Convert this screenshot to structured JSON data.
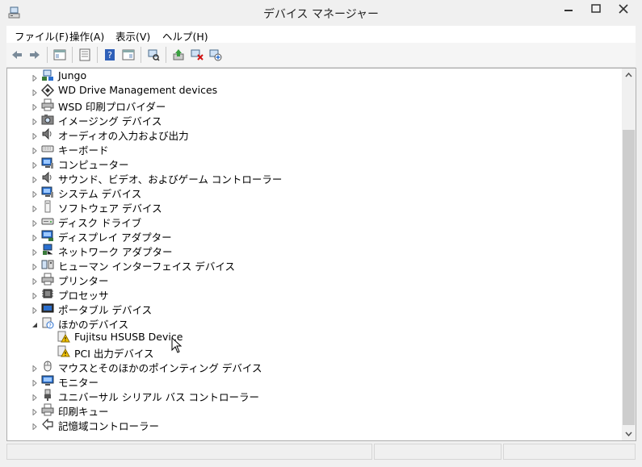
{
  "window": {
    "title": "デバイス マネージャー",
    "icon": "device-manager-icon"
  },
  "menubar": {
    "items": [
      {
        "label": "ファイル(F)"
      },
      {
        "label": "操作(A)"
      },
      {
        "label": "表示(V)"
      },
      {
        "label": "ヘルプ(H)"
      }
    ]
  },
  "toolbar": {
    "buttons": [
      {
        "icon": "back-arrow-icon"
      },
      {
        "icon": "forward-arrow-icon"
      },
      {
        "icon": "show-hide-console-tree-icon"
      },
      {
        "icon": "properties-icon"
      },
      {
        "icon": "help-icon"
      },
      {
        "icon": "action-pane-icon"
      },
      {
        "icon": "scan-hardware-changes-icon"
      },
      {
        "icon": "update-driver-icon"
      },
      {
        "icon": "uninstall-device-icon"
      },
      {
        "icon": "add-legacy-hardware-icon"
      }
    ]
  },
  "tree": {
    "items": [
      {
        "label": "Jungo",
        "icon": "network-device-icon",
        "expanded": false,
        "level": 1
      },
      {
        "label": "WD Drive Management devices",
        "icon": "wd-diamond-icon",
        "expanded": false,
        "level": 1
      },
      {
        "label": "WSD 印刷プロバイダー",
        "icon": "printer-icon",
        "expanded": false,
        "level": 1
      },
      {
        "label": "イメージング デバイス",
        "icon": "camera-icon",
        "expanded": false,
        "level": 1
      },
      {
        "label": "オーディオの入力および出力",
        "icon": "speaker-icon",
        "expanded": false,
        "level": 1
      },
      {
        "label": "キーボード",
        "icon": "keyboard-icon",
        "expanded": false,
        "level": 1
      },
      {
        "label": "コンピューター",
        "icon": "computer-icon",
        "expanded": false,
        "level": 1
      },
      {
        "label": "サウンド、ビデオ、およびゲーム コントローラー",
        "icon": "speaker-icon",
        "expanded": false,
        "level": 1
      },
      {
        "label": "システム デバイス",
        "icon": "computer-icon",
        "expanded": false,
        "level": 1
      },
      {
        "label": "ソフトウェア デバイス",
        "icon": "software-device-icon",
        "expanded": false,
        "level": 1
      },
      {
        "label": "ディスク ドライブ",
        "icon": "disk-drive-icon",
        "expanded": false,
        "level": 1
      },
      {
        "label": "ディスプレイ アダプター",
        "icon": "display-adapter-icon",
        "expanded": false,
        "level": 1
      },
      {
        "label": "ネットワーク アダプター",
        "icon": "network-adapter-icon",
        "expanded": false,
        "level": 1
      },
      {
        "label": "ヒューマン インターフェイス デバイス",
        "icon": "hid-icon",
        "expanded": false,
        "level": 1
      },
      {
        "label": "プリンター",
        "icon": "printer-icon",
        "expanded": false,
        "level": 1
      },
      {
        "label": "プロセッサ",
        "icon": "processor-icon",
        "expanded": false,
        "level": 1
      },
      {
        "label": "ポータブル デバイス",
        "icon": "portable-device-icon",
        "expanded": false,
        "level": 1
      },
      {
        "label": "ほかのデバイス",
        "icon": "other-devices-icon",
        "expanded": true,
        "level": 1
      },
      {
        "label": "Fujitsu HSUSB Device",
        "icon": "warning-device-icon",
        "expanded": null,
        "level": 2
      },
      {
        "label": "PCI 出力デバイス",
        "icon": "warning-device-icon",
        "expanded": null,
        "level": 2
      },
      {
        "label": "マウスとそのほかのポインティング デバイス",
        "icon": "mouse-icon",
        "expanded": false,
        "level": 1
      },
      {
        "label": "モニター",
        "icon": "monitor-icon",
        "expanded": false,
        "level": 1
      },
      {
        "label": "ユニバーサル シリアル バス コントローラー",
        "icon": "usb-icon",
        "expanded": false,
        "level": 1
      },
      {
        "label": "印刷キュー",
        "icon": "printer-icon",
        "expanded": false,
        "level": 1
      },
      {
        "label": "記憶域コントローラー",
        "icon": "storage-controller-icon",
        "expanded": false,
        "level": 1
      }
    ]
  },
  "colors": {
    "window_bg": "#f0f0f0",
    "tree_bg": "#ffffff",
    "warning_yellow": "#f5c400",
    "icon_blue": "#2a6fcf"
  }
}
